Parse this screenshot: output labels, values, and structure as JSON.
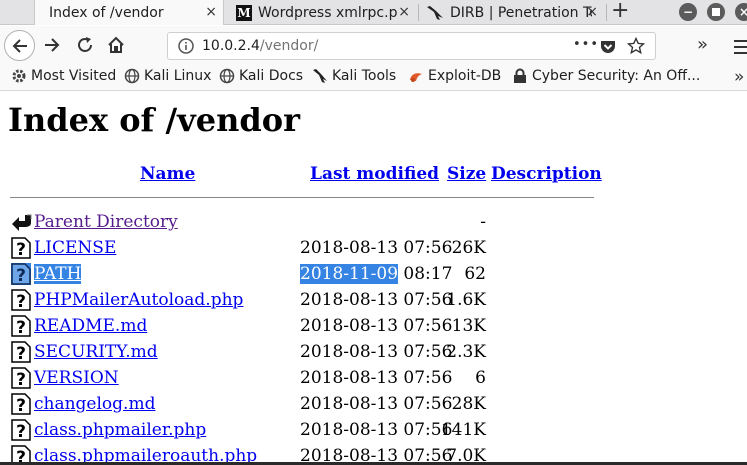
{
  "tabs": [
    {
      "title": "Index of /vendor",
      "close": "×"
    },
    {
      "title": "Wordpress xmlrpc.php",
      "favicon": "M",
      "close": "×"
    },
    {
      "title": "DIRB | Penetration Testing Tools",
      "close": "×"
    }
  ],
  "newtab_label": "+",
  "window_controls": {
    "minimize": "−",
    "maximize": "◆",
    "close": "×"
  },
  "nav": {
    "url_host": "10.0.2.4",
    "url_path": "/vendor/",
    "overflow_label": "•••",
    "chevron_label": "»"
  },
  "bookmarks": [
    {
      "label": "Most Visited",
      "icon": "gear-icon"
    },
    {
      "label": "Kali Linux",
      "icon": "globe-icon"
    },
    {
      "label": "Kali Docs",
      "icon": "globe-icon"
    },
    {
      "label": "Kali Tools",
      "icon": "kali-dragon-icon"
    },
    {
      "label": "Exploit-DB",
      "icon": "exploit-db-icon"
    },
    {
      "label": "Cyber Security: An Off...",
      "icon": "lock-icon"
    }
  ],
  "page": {
    "heading": "Index of /vendor",
    "columns": {
      "name": "Name",
      "last_modified": "Last modified",
      "size": "Size",
      "description": "Description"
    },
    "rows": [
      {
        "name": "Parent Directory",
        "date": "",
        "size": "-",
        "type": "parent"
      },
      {
        "name": "LICENSE",
        "date": "2018-08-13 07:56",
        "size": "26K",
        "type": "file"
      },
      {
        "name": "PATH",
        "date_selected": "2018-11-09",
        "date_rest": " 08:17",
        "size": "62",
        "type": "file",
        "selected": true
      },
      {
        "name": "PHPMailerAutoload.php",
        "date": "2018-08-13 07:56",
        "size": "1.6K",
        "type": "file"
      },
      {
        "name": "README.md",
        "date": "2018-08-13 07:56",
        "size": "13K",
        "type": "file"
      },
      {
        "name": "SECURITY.md",
        "date": "2018-08-13 07:56",
        "size": "2.3K",
        "type": "file"
      },
      {
        "name": "VERSION",
        "date": "2018-08-13 07:56",
        "size": "6",
        "type": "file"
      },
      {
        "name": "changelog.md",
        "date": "2018-08-13 07:56",
        "size": "28K",
        "type": "file"
      },
      {
        "name": "class.phpmailer.php",
        "date": "2018-08-13 07:56",
        "size": "141K",
        "type": "file"
      },
      {
        "name": "class.phpmaileroauth.php",
        "date": "2018-08-13 07:56",
        "size": "7.0K",
        "type": "file"
      }
    ]
  },
  "colors": {
    "link": "#0000ee",
    "visited": "#551a8b",
    "selection": "#3584e4"
  }
}
